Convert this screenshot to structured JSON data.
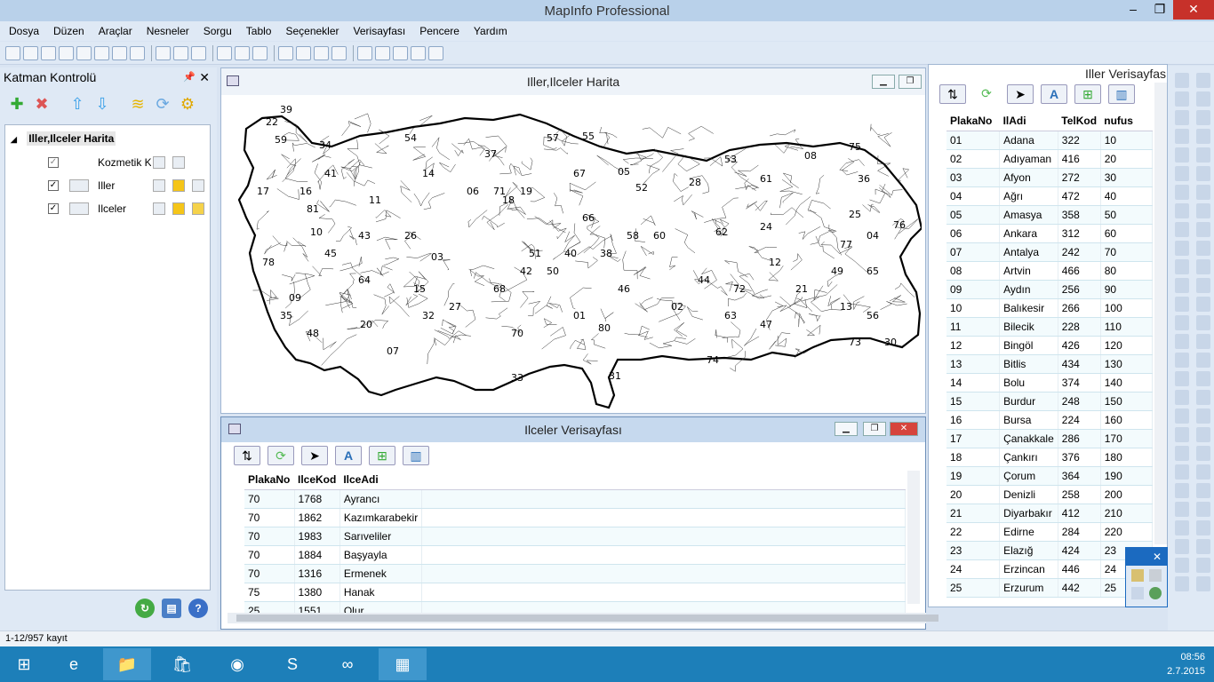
{
  "window": {
    "title": "MapInfo Professional"
  },
  "menu": [
    "Dosya",
    "Düzen",
    "Araçlar",
    "Nesneler",
    "Sorgu",
    "Tablo",
    "Seçenekler",
    "Verisayfası",
    "Pencere",
    "Yardım"
  ],
  "layer_control": {
    "title": "Katman Kontrolü",
    "root": "Iller,Ilceler Harita",
    "layers": [
      {
        "name": "Kozmetik Katman",
        "checked": true
      },
      {
        "name": "Iller",
        "checked": true
      },
      {
        "name": "Ilceler",
        "checked": true
      }
    ]
  },
  "map_window": {
    "title": "Iller,Ilceler Harita",
    "labels": [
      "39",
      "22",
      "59",
      "34",
      "41",
      "54",
      "17",
      "16",
      "10",
      "45",
      "43",
      "26",
      "06",
      "71",
      "19",
      "18",
      "37",
      "57",
      "55",
      "05",
      "52",
      "28",
      "61",
      "53",
      "08",
      "75",
      "36",
      "25",
      "24",
      "62",
      "12",
      "04",
      "76",
      "58",
      "66",
      "60",
      "42",
      "03",
      "15",
      "64",
      "35",
      "48",
      "09",
      "20",
      "07",
      "32",
      "70",
      "01",
      "80",
      "31",
      "33",
      "46",
      "44",
      "02",
      "63",
      "47",
      "21",
      "49",
      "13",
      "56",
      "65",
      "73",
      "30",
      "68",
      "51",
      "40",
      "50",
      "38",
      "72",
      "27",
      "14",
      "67",
      "74",
      "78",
      "81",
      "11",
      "77"
    ]
  },
  "ilce_table": {
    "title": "Ilceler Verisayfası",
    "columns": [
      "PlakaNo",
      "IlceKod",
      "IlceAdi"
    ],
    "rows": [
      [
        "70",
        "1768",
        "Ayrancı"
      ],
      [
        "70",
        "1862",
        "Kazımkarabekir"
      ],
      [
        "70",
        "1983",
        "Sarıveliler"
      ],
      [
        "70",
        "1884",
        "Başyayla"
      ],
      [
        "70",
        "1316",
        "Ermenek"
      ],
      [
        "75",
        "1380",
        "Hanak"
      ],
      [
        "25",
        "1551",
        "Olur"
      ]
    ]
  },
  "il_table": {
    "title": "Iller Verisayfası",
    "columns": [
      "PlakaNo",
      "IlAdi",
      "TelKod",
      "nufus"
    ],
    "rows": [
      [
        "01",
        "Adana",
        "322",
        "10"
      ],
      [
        "02",
        "Adıyaman",
        "416",
        "20"
      ],
      [
        "03",
        "Afyon",
        "272",
        "30"
      ],
      [
        "04",
        "Ağrı",
        "472",
        "40"
      ],
      [
        "05",
        "Amasya",
        "358",
        "50"
      ],
      [
        "06",
        "Ankara",
        "312",
        "60"
      ],
      [
        "07",
        "Antalya",
        "242",
        "70"
      ],
      [
        "08",
        "Artvin",
        "466",
        "80"
      ],
      [
        "09",
        "Aydın",
        "256",
        "90"
      ],
      [
        "10",
        "Balıkesir",
        "266",
        "100"
      ],
      [
        "11",
        "Bilecik",
        "228",
        "110"
      ],
      [
        "12",
        "Bingöl",
        "426",
        "120"
      ],
      [
        "13",
        "Bitlis",
        "434",
        "130"
      ],
      [
        "14",
        "Bolu",
        "374",
        "140"
      ],
      [
        "15",
        "Burdur",
        "248",
        "150"
      ],
      [
        "16",
        "Bursa",
        "224",
        "160"
      ],
      [
        "17",
        "Çanakkale",
        "286",
        "170"
      ],
      [
        "18",
        "Çankırı",
        "376",
        "180"
      ],
      [
        "19",
        "Çorum",
        "364",
        "190"
      ],
      [
        "20",
        "Denizli",
        "258",
        "200"
      ],
      [
        "21",
        "Diyarbakır",
        "412",
        "210"
      ],
      [
        "22",
        "Edirne",
        "284",
        "220"
      ],
      [
        "23",
        "Elazığ",
        "424",
        "23"
      ],
      [
        "24",
        "Erzincan",
        "446",
        "24"
      ],
      [
        "25",
        "Erzurum",
        "442",
        "25"
      ]
    ]
  },
  "status": {
    "text": "1-12/957 kayıt"
  },
  "taskbar": {
    "time": "08:56",
    "date": "2.7.2015"
  }
}
